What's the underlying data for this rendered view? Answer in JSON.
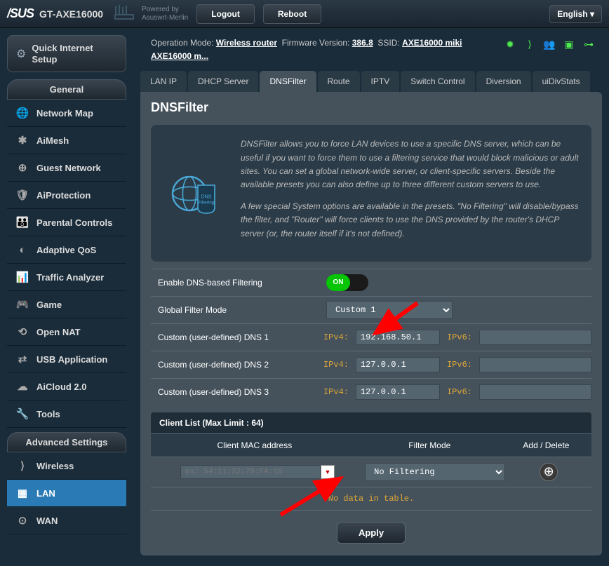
{
  "brand": "/SUS",
  "model": "GT-AXE16000",
  "powered_by_label": "Powered by",
  "powered_by_value": "Asuswrt-Merlin",
  "top_buttons": {
    "logout": "Logout",
    "reboot": "Reboot"
  },
  "language": "English",
  "status": {
    "opmode_label": "Operation Mode:",
    "opmode_value": "Wireless router",
    "fw_label": "Firmware Version:",
    "fw_value": "386.8",
    "ssid_label": "SSID:",
    "ssid_value": "AXE16000 miki AXE16000 m..."
  },
  "sidebar": {
    "qis": "Quick Internet Setup",
    "general_header": "General",
    "general": [
      "Network Map",
      "AiMesh",
      "Guest Network",
      "AiProtection",
      "Parental Controls",
      "Adaptive QoS",
      "Traffic Analyzer",
      "Game",
      "Open NAT",
      "USB Application",
      "AiCloud 2.0",
      "Tools"
    ],
    "advanced_header": "Advanced Settings",
    "advanced": [
      "Wireless",
      "LAN",
      "WAN"
    ]
  },
  "tabs": [
    "LAN IP",
    "DHCP Server",
    "DNSFilter",
    "Route",
    "IPTV",
    "Switch Control",
    "Diversion",
    "uiDivStats"
  ],
  "active_tab": "DNSFilter",
  "page_title": "DNSFilter",
  "desc": {
    "p1": "DNSFilter allows you to force LAN devices to use a specific DNS server, which can be useful if you want to force them to use a filtering service that would block malicious or adult sites. You can set a global network-wide server, or client-specific servers. Beside the available presets you can also define up to three different custom servers to use.",
    "p2": "A few special System options are available in the presets. \"No Filtering\" will disable/bypass the filter, and \"Router\" will force clients to use the DNS provided by the router's DHCP server (or, the router itself if it's not defined)."
  },
  "form": {
    "enable_label": "Enable DNS-based Filtering",
    "enable_value": "ON",
    "global_label": "Global Filter Mode",
    "global_value": "Custom 1",
    "dns1_label": "Custom (user-defined) DNS 1",
    "dns2_label": "Custom (user-defined) DNS 2",
    "dns3_label": "Custom (user-defined) DNS 3",
    "ipv4_label": "IPv4:",
    "ipv6_label": "IPv6:",
    "dns1_ipv4": "192.168.50.1",
    "dns2_ipv4": "127.0.0.1",
    "dns3_ipv4": "127.0.0.1",
    "dns1_ipv6": "",
    "dns2_ipv6": "",
    "dns3_ipv6": ""
  },
  "client": {
    "header": "Client List (Max Limit : 64)",
    "col_mac": "Client MAC address",
    "col_filter": "Filter Mode",
    "col_action": "Add / Delete",
    "mac_placeholder": "ex: 54:11:22:78:FA:16",
    "filter_value": "No Filtering",
    "no_data": "No data in table."
  },
  "apply": "Apply"
}
